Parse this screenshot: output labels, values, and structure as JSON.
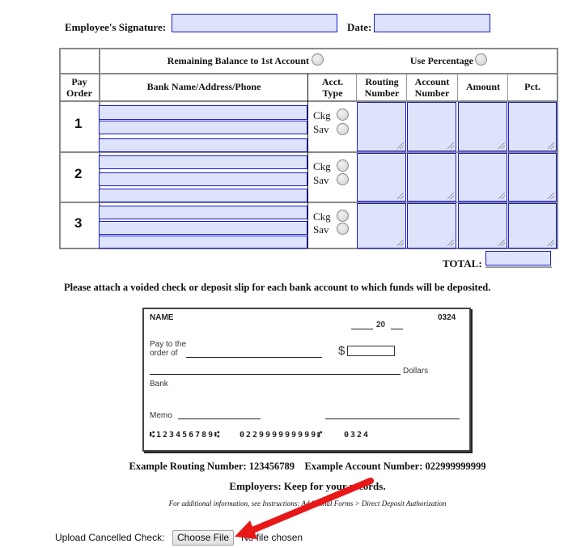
{
  "signature": {
    "label": "Employee's Signature:",
    "date_label": "Date:",
    "signature_value": "",
    "date_value": ""
  },
  "table": {
    "remaining_balance_label": "Remaining Balance to 1st Account",
    "use_percentage_label": "Use Percentage",
    "headers": [
      "Pay Order",
      "Bank Name/Address/Phone",
      "Acct. Type",
      "Routing Number",
      "Account Number",
      "Amount",
      "Pct."
    ],
    "header_lines": {
      "pay_order": [
        "Pay",
        "Order"
      ],
      "bank": "Bank Name/Address/Phone",
      "acct_type": [
        "Acct.",
        "Type"
      ],
      "routing": [
        "Routing",
        "Number"
      ],
      "account": [
        "Account",
        "Number"
      ],
      "amount": "Amount",
      "pct": "Pct."
    },
    "rows": [
      {
        "order": "1",
        "bank_lines": [
          "",
          "",
          ""
        ],
        "ckg_label": "Ckg",
        "sav_label": "Sav",
        "routing": "",
        "account": "",
        "amount": "",
        "pct": ""
      },
      {
        "order": "2",
        "bank_lines": [
          "",
          "",
          ""
        ],
        "ckg_label": "Ckg",
        "sav_label": "Sav",
        "routing": "",
        "account": "",
        "amount": "",
        "pct": ""
      },
      {
        "order": "3",
        "bank_lines": [
          "",
          "",
          ""
        ],
        "ckg_label": "Ckg",
        "sav_label": "Sav",
        "routing": "",
        "account": "",
        "amount": "",
        "pct": ""
      }
    ],
    "total_label": "TOTAL:",
    "total_value": ""
  },
  "instruction": "Please attach a voided check or deposit slip for each bank account to which funds will be deposited.",
  "check": {
    "name": "NAME",
    "number": "0324",
    "date_year": "20",
    "pay_to_line1": "Pay to the",
    "pay_to_line2": "order of",
    "dollar_sign": "$",
    "dollars": "Dollars",
    "bank": "Bank",
    "memo": "Memo",
    "micr_routing": "⑆123456789⑆",
    "micr_account": "022999999999⑈",
    "micr_check": "0324"
  },
  "example_text": "Example Routing Number: 123456789    Example Account Number: 022999999999",
  "employers_note": "Employers: Keep for your records.",
  "additional_info": "For additional information, see Instructions: Additional Forms > Direct Deposit Authorization",
  "upload": {
    "label": "Upload Cancelled Check:",
    "button": "Choose File",
    "status": "No file chosen"
  },
  "annotation": {
    "arrow_color": "#e81818"
  }
}
